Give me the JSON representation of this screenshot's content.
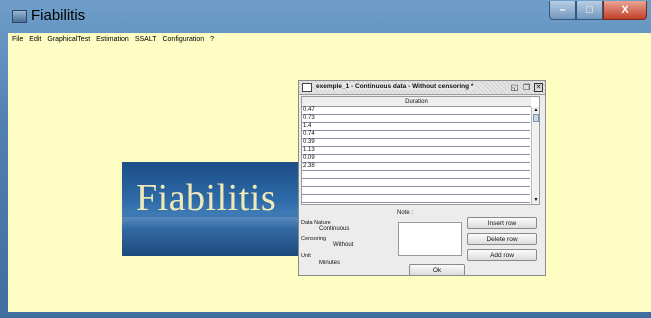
{
  "window": {
    "title": "Fiabilitis",
    "minimize": "–",
    "maximize": "□",
    "close": "X"
  },
  "menubar": {
    "items": [
      "File",
      "Edit",
      "GraphicalTest",
      "Estimation",
      "SSALT",
      "Configuration",
      "?"
    ]
  },
  "splash": {
    "title": "Fiabilitis"
  },
  "dialog": {
    "title": "exemple_1 - Continuous data - Without censoring *",
    "column_header": "Duration",
    "rows": [
      "0.47",
      "0.73",
      "1.4",
      "0.74",
      "0.39",
      "1.13",
      "0.09",
      "2.38",
      "",
      "",
      "",
      ""
    ],
    "note_label": "Note :",
    "data_nature_label": "Data Nature",
    "data_nature_value": "Continuous",
    "censoring_label": "Censoring",
    "censoring_value": "Without",
    "unit_label": "Unit",
    "unit_value": "Minutes",
    "buttons": {
      "insert_row": "Insert row",
      "delete_row": "Delete row",
      "add_row": "Add row",
      "ok": "Ok"
    }
  }
}
